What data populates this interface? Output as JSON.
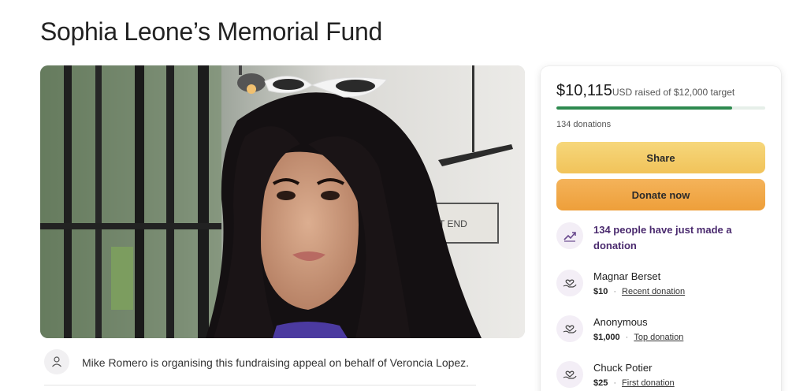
{
  "page_title": "Sophia Leone’s Memorial Fund",
  "organiser": {
    "text": "Mike Romero is organising this fundraising appeal on behalf of Veroncia Lopez."
  },
  "progress": {
    "amount": "$10,115",
    "rest": "USD raised of $12,000 target",
    "fraction": 0.843,
    "donations_count": "134 donations"
  },
  "buttons": {
    "share": "Share",
    "donate": "Donate now"
  },
  "trend": {
    "text": "134 people have just made a donation"
  },
  "donors": [
    {
      "name": "Magnar Berset",
      "amount": "$10",
      "tag": "Recent donation"
    },
    {
      "name": "Anonymous",
      "amount": "$1,000",
      "tag": "Top donation"
    },
    {
      "name": "Chuck Potier",
      "amount": "$25",
      "tag": "First donation"
    }
  ],
  "colors": {
    "progress_fill": "#2e8a4f",
    "share_button": "#f3cb68",
    "donate_button": "#f0a848",
    "accent_purple": "#4a2a6e"
  },
  "hero_image": {
    "description_icon": "photo"
  },
  "cafe_sign": "EST END"
}
